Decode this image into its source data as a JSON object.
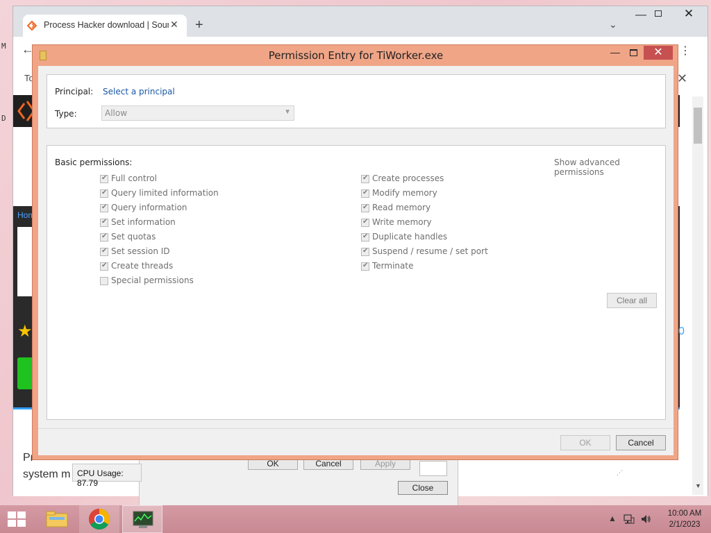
{
  "desktop": {
    "glyph_top": "M",
    "glyph_mid": "D"
  },
  "browser": {
    "tab_title": "Process Hacker download | SourceForge.net",
    "tab_close": "✕",
    "new_tab": "+",
    "tab_search": "⌄",
    "min": "—",
    "close": "✕",
    "back": "←",
    "menu": "⋮",
    "info_prefix": "To",
    "info_close": "✕",
    "home_link": "Hom",
    "star": "★",
    "right_num": "0",
    "body_line1": "Pr",
    "body_line2": "system m"
  },
  "process_hacker": {
    "ok": "OK",
    "cancel": "Cancel",
    "apply": "Apply",
    "close": "Close",
    "cpu_usage": "CPU Usage: 87.79"
  },
  "dialog": {
    "title": "Permission Entry for TiWorker.exe",
    "principal_label": "Principal:",
    "principal_link": "Select a principal",
    "type_label": "Type:",
    "type_value": "Allow",
    "basic_permissions_label": "Basic permissions:",
    "show_advanced": "Show advanced permissions",
    "clear_all": "Clear all",
    "ok": "OK",
    "cancel": "Cancel",
    "permissions_left": [
      {
        "label": "Full control",
        "checked": true
      },
      {
        "label": "Query limited information",
        "checked": true
      },
      {
        "label": "Query information",
        "checked": true
      },
      {
        "label": "Set information",
        "checked": true
      },
      {
        "label": "Set quotas",
        "checked": true
      },
      {
        "label": "Set session ID",
        "checked": true
      },
      {
        "label": "Create threads",
        "checked": true
      },
      {
        "label": "Special permissions",
        "checked": false
      }
    ],
    "permissions_right": [
      {
        "label": "Create processes",
        "checked": true
      },
      {
        "label": "Modify memory",
        "checked": true
      },
      {
        "label": "Read memory",
        "checked": true
      },
      {
        "label": "Write memory",
        "checked": true
      },
      {
        "label": "Duplicate handles",
        "checked": true
      },
      {
        "label": "Suspend / resume / set port",
        "checked": true
      },
      {
        "label": "Terminate",
        "checked": true
      }
    ]
  },
  "taskbar": {
    "time": "10:00 AM",
    "date": "2/1/2023"
  },
  "colors": {
    "dialog_border": "#f0a587",
    "close_red": "#c75050",
    "link_blue": "#1a57a6",
    "taskbar": "#c88993"
  }
}
